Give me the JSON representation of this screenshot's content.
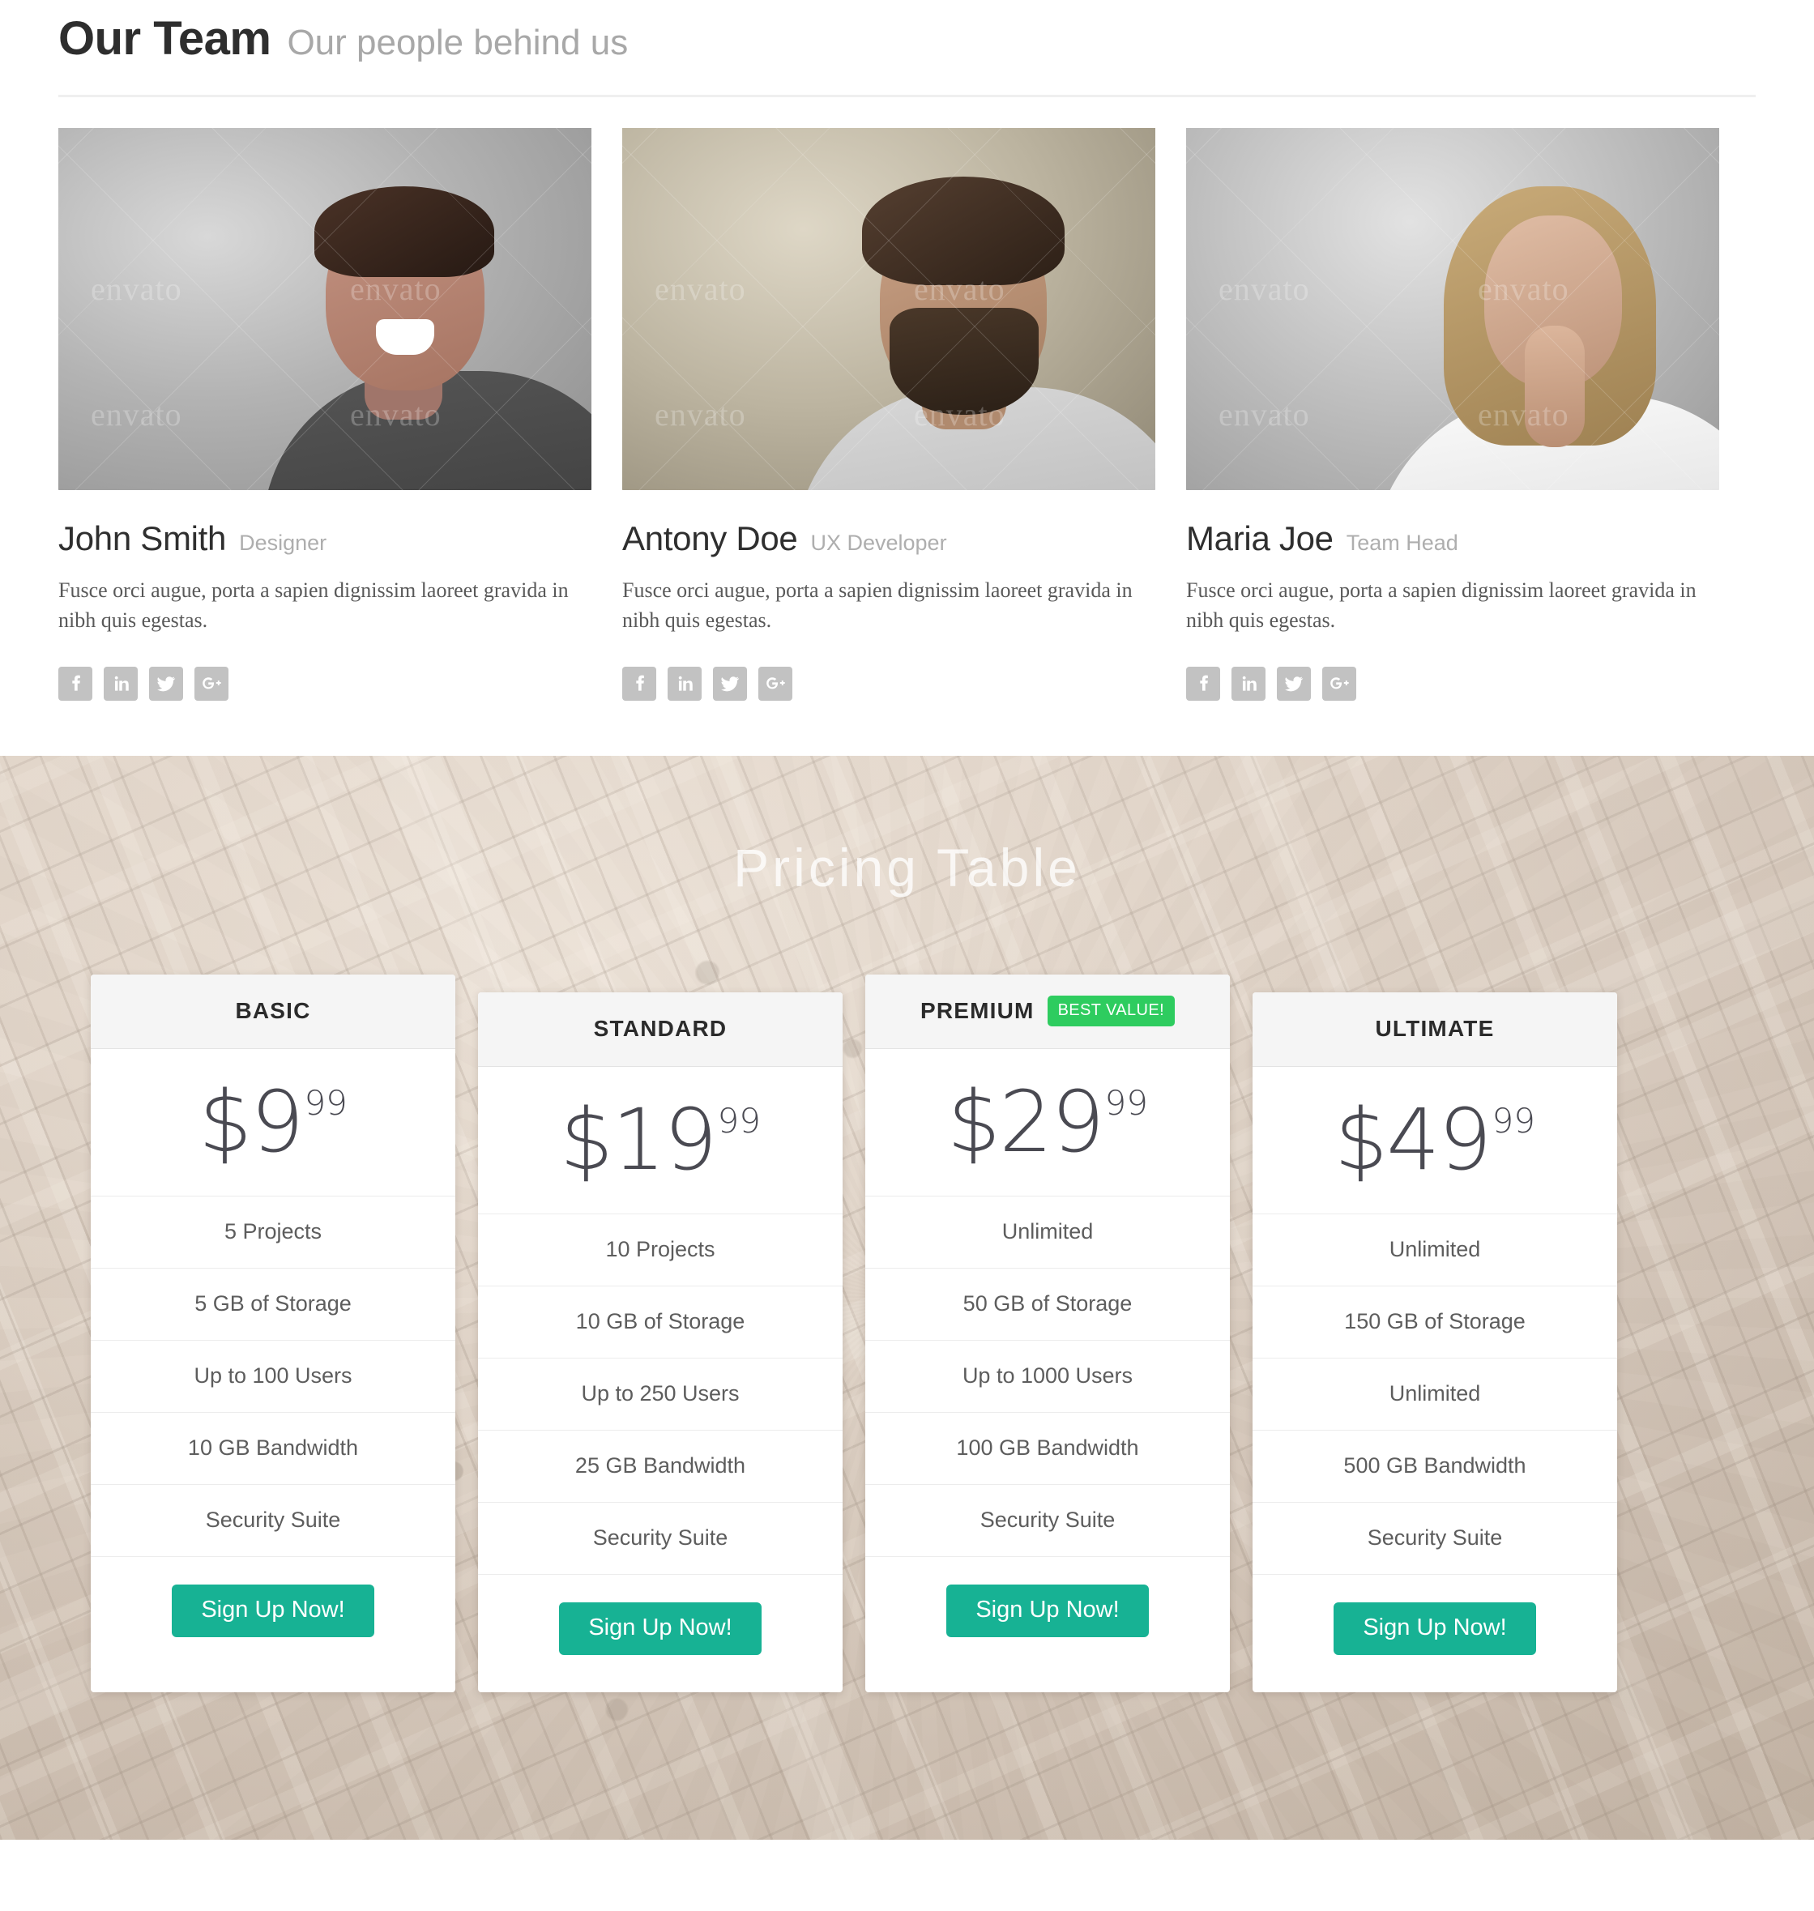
{
  "team_section": {
    "title": "Our Team",
    "subtitle": "Our people behind us",
    "members": [
      {
        "name": "John Smith",
        "role": "Designer",
        "bio": "Fusce orci augue, porta a sapien dignissim laoreet gravida in nibh quis egestas.",
        "photo_watermark": "envato",
        "photo_alt": "Laughing man in dark shirt against gray backdrop",
        "socials": [
          "facebook-icon",
          "linkedin-icon",
          "twitter-icon",
          "googleplus-icon"
        ]
      },
      {
        "name": "Antony Doe",
        "role": "UX Developer",
        "bio": "Fusce orci augue, porta a sapien dignissim laoreet gravida in nibh quis egestas.",
        "photo_watermark": "envato",
        "photo_alt": "Bearded curly-haired man in gray t-shirt against beige backdrop",
        "socials": [
          "facebook-icon",
          "linkedin-icon",
          "twitter-icon",
          "googleplus-icon"
        ]
      },
      {
        "name": "Maria Joe",
        "role": "Team Head",
        "bio": "Fusce orci augue, porta a sapien dignissim laoreet gravida in nibh quis egestas.",
        "photo_watermark": "envato",
        "photo_alt": "Blonde woman in white shirt making a shush gesture",
        "socials": [
          "facebook-icon",
          "linkedin-icon",
          "twitter-icon",
          "googleplus-icon"
        ]
      }
    ]
  },
  "pricing_section": {
    "title": "Pricing Table",
    "background_alt": "Sepia-toned aerial photograph of a city downtown",
    "cta_label": "Sign Up Now!",
    "plans": [
      {
        "name": "BASIC",
        "badge": null,
        "currency": "$",
        "amount": "9",
        "cents": "99",
        "features": [
          "5 Projects",
          "5 GB of Storage",
          "Up to 100 Users",
          "10 GB Bandwidth",
          "Security Suite"
        ],
        "cta": "Sign Up Now!"
      },
      {
        "name": "STANDARD",
        "badge": null,
        "currency": "$",
        "amount": "19",
        "cents": "99",
        "features": [
          "10 Projects",
          "10 GB of Storage",
          "Up to 250 Users",
          "25 GB Bandwidth",
          "Security Suite"
        ],
        "cta": "Sign Up Now!"
      },
      {
        "name": "PREMIUM",
        "badge": "BEST VALUE!",
        "currency": "$",
        "amount": "29",
        "cents": "99",
        "features": [
          "Unlimited",
          "50 GB of Storage",
          "Up to 1000 Users",
          "100 GB Bandwidth",
          "Security Suite"
        ],
        "cta": "Sign Up Now!"
      },
      {
        "name": "ULTIMATE",
        "badge": null,
        "currency": "$",
        "amount": "49",
        "cents": "99",
        "features": [
          "Unlimited",
          "150 GB of Storage",
          "Unlimited",
          "500 GB Bandwidth",
          "Security Suite"
        ],
        "cta": "Sign Up Now!"
      }
    ]
  },
  "colors": {
    "accent_green": "#17b294",
    "badge_green": "#2ecc5f",
    "heading_dark": "#2e2e2e",
    "muted_gray": "#a8a8a8",
    "body_text": "#595959",
    "card_head_bg": "#f5f5f5",
    "social_icon_bg": "#c2c2c2"
  }
}
